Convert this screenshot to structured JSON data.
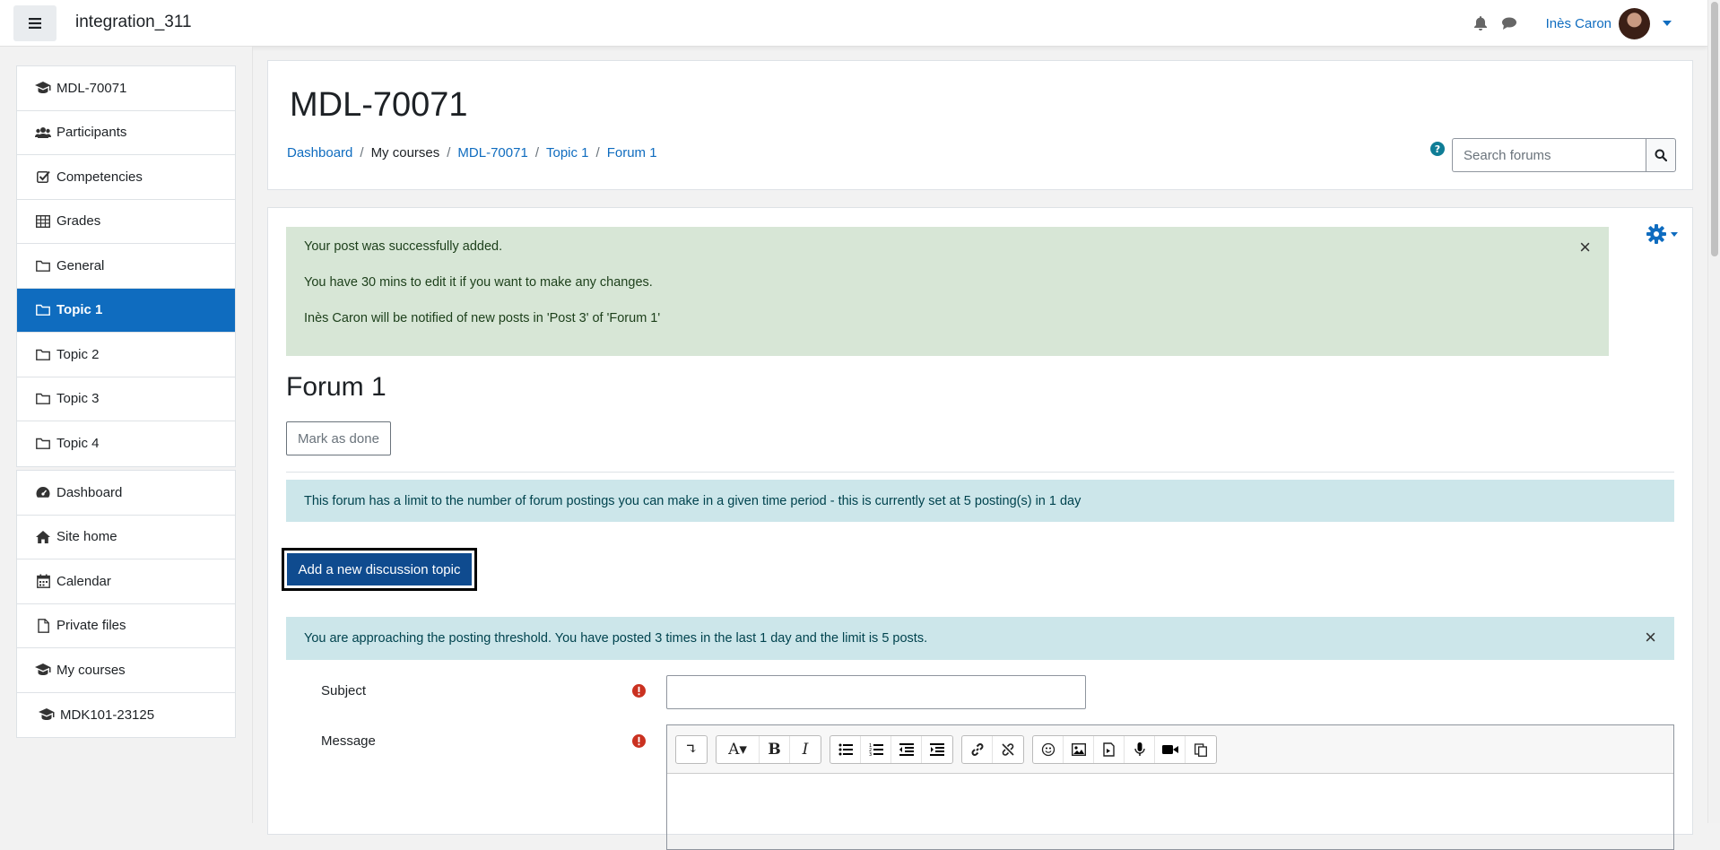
{
  "navbar": {
    "site_name": "integration_311",
    "user_name": "Inès Caron"
  },
  "drawer": {
    "course_items": [
      {
        "label": "MDL-70071",
        "icon": "graduation-cap-icon"
      },
      {
        "label": "Participants",
        "icon": "users-icon"
      },
      {
        "label": "Competencies",
        "icon": "check-square-icon"
      },
      {
        "label": "Grades",
        "icon": "table-icon"
      },
      {
        "label": "General",
        "icon": "folder-icon"
      },
      {
        "label": "Topic 1",
        "icon": "folder-icon",
        "active": true
      },
      {
        "label": "Topic 2",
        "icon": "folder-icon"
      },
      {
        "label": "Topic 3",
        "icon": "folder-icon"
      },
      {
        "label": "Topic 4",
        "icon": "folder-icon"
      }
    ],
    "site_items": [
      {
        "label": "Dashboard",
        "icon": "dashboard-icon"
      },
      {
        "label": "Site home",
        "icon": "home-icon"
      },
      {
        "label": "Calendar",
        "icon": "calendar-icon"
      },
      {
        "label": "Private files",
        "icon": "file-icon"
      },
      {
        "label": "My courses",
        "icon": "graduation-cap-icon"
      },
      {
        "label": "MDK101-23125",
        "icon": "graduation-cap-icon"
      }
    ]
  },
  "header": {
    "title": "MDL-70071",
    "breadcrumb": [
      "Dashboard",
      "My courses",
      "MDL-70071",
      "Topic 1",
      "Forum 1"
    ],
    "search_placeholder": "Search forums"
  },
  "main": {
    "success_alert": {
      "line1": "Your post was successfully added.",
      "line2": "You have 30 mins to edit it if you want to make any changes.",
      "line3": "Inès Caron will be notified of new posts in 'Post 3' of 'Forum 1'"
    },
    "forum_title": "Forum 1",
    "mark_done_label": "Mark as done",
    "limit_info": "This forum has a limit to the number of forum postings you can make in a given time period - this is currently set at 5 posting(s) in 1 day",
    "add_topic_label": "Add a new discussion topic",
    "threshold_info": "You are approaching the posting threshold. You have posted 3 times in the last 1 day and the limit is 5 posts.",
    "form": {
      "subject_label": "Subject",
      "message_label": "Message",
      "subject_value": ""
    }
  },
  "colors": {
    "brand": "#0f6cbf",
    "success_bg": "#d7e6d6",
    "info_bg": "#cce6ea",
    "required": "#ca3120"
  }
}
